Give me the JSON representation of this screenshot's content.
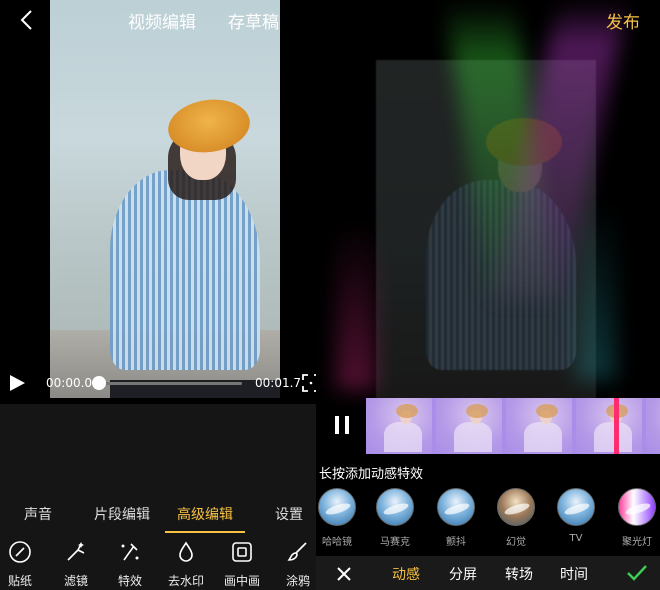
{
  "header": {
    "title": "视频编辑",
    "draft_label": "存草稿",
    "publish_label": "发布"
  },
  "player": {
    "current_time": "00:00.0",
    "total_time": "00:01.7",
    "progress": 0.0
  },
  "edit_tabs": [
    {
      "label": "声音",
      "active": false
    },
    {
      "label": "片段编辑",
      "active": false
    },
    {
      "label": "高级编辑",
      "active": true
    },
    {
      "label": "设置",
      "active": false
    }
  ],
  "tools": [
    {
      "label": "贴纸",
      "icon": "sticker-icon"
    },
    {
      "label": "滤镜",
      "icon": "filter-icon"
    },
    {
      "label": "特效",
      "icon": "effects-icon"
    },
    {
      "label": "去水印",
      "icon": "remove-watermark-icon"
    },
    {
      "label": "画中画",
      "icon": "picture-in-picture-icon"
    },
    {
      "label": "涂鸦",
      "icon": "doodle-icon"
    }
  ],
  "effects_panel": {
    "hint": "长按添加动感特效",
    "effects": [
      {
        "label": "哈哈镜"
      },
      {
        "label": "马赛克"
      },
      {
        "label": "颤抖"
      },
      {
        "label": "幻觉"
      },
      {
        "label": "TV"
      },
      {
        "label": "聚光灯"
      }
    ],
    "bottom_tabs": [
      {
        "label": "动感",
        "active": true
      },
      {
        "label": "分屏",
        "active": false
      },
      {
        "label": "转场",
        "active": false
      },
      {
        "label": "时间",
        "active": false
      }
    ]
  },
  "colors": {
    "accent": "#f6c243",
    "timeline": "#a98de8",
    "playhead": "#ff2d6f",
    "confirm": "#3ecf57"
  }
}
